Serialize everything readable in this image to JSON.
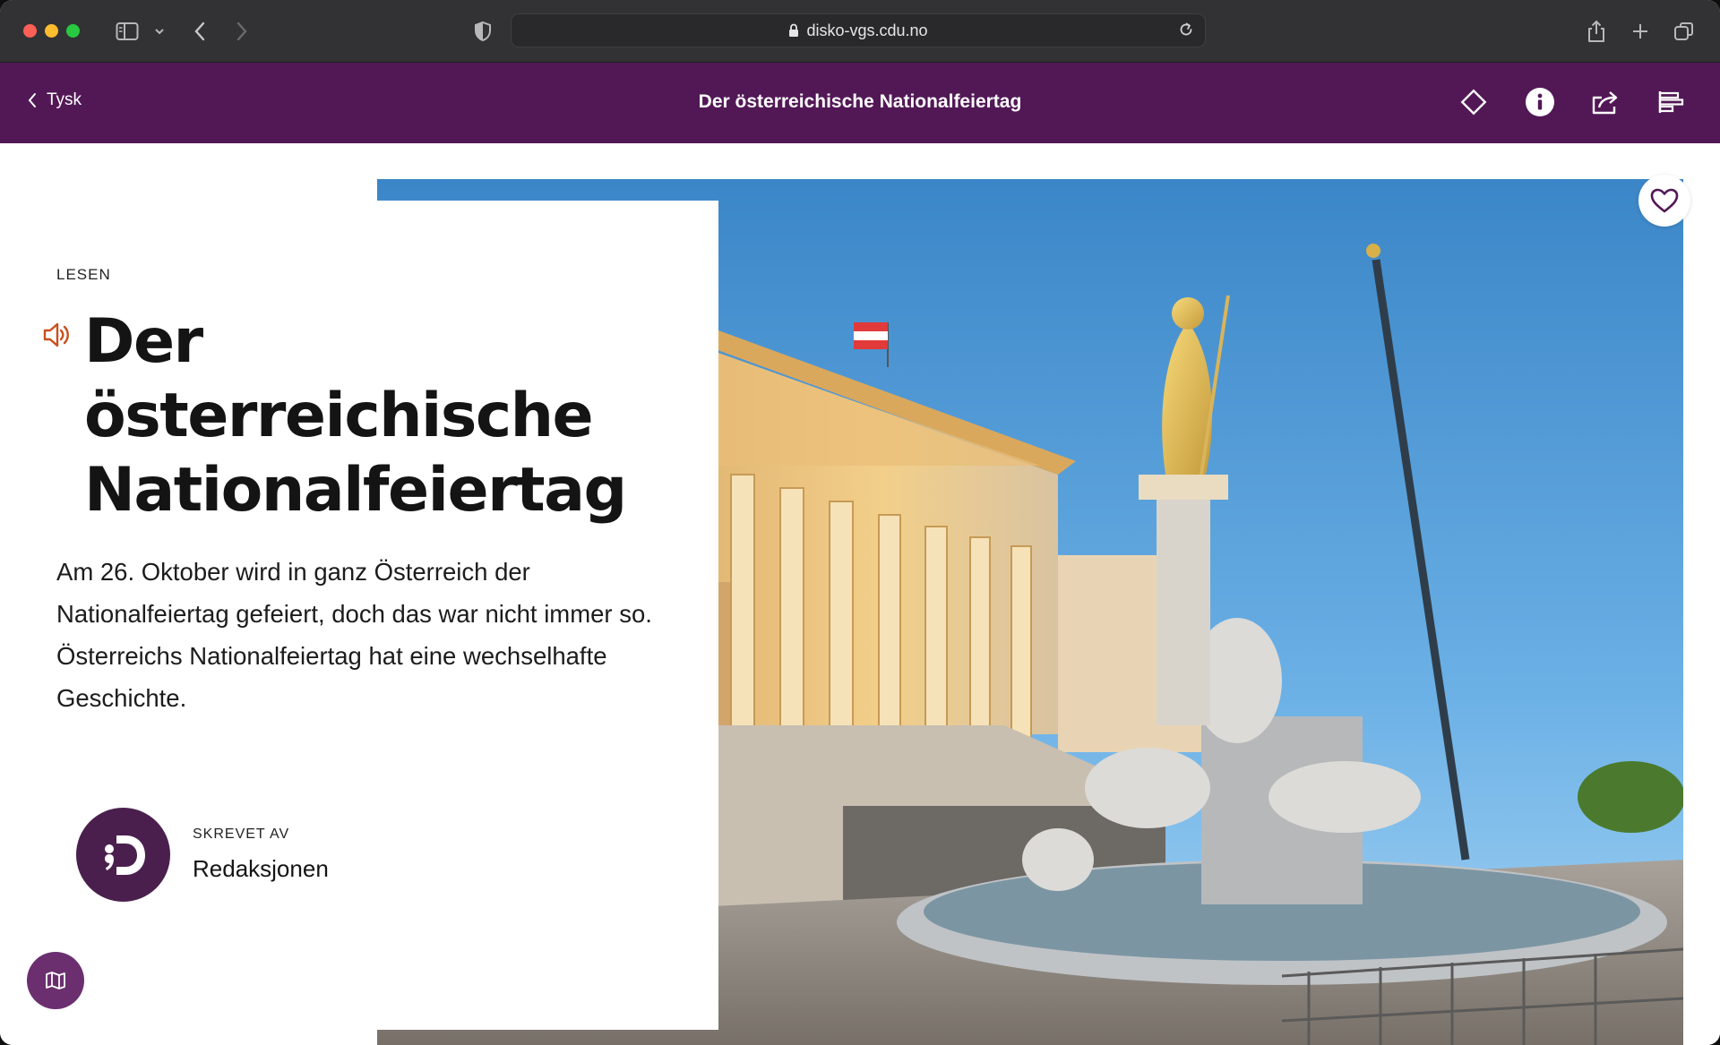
{
  "browser": {
    "url": "disko-vgs.cdu.no",
    "icons": [
      "sidebar-icon",
      "chevron-down-icon",
      "back-icon",
      "forward-icon",
      "shield-icon",
      "lock-icon",
      "reload-icon",
      "share-icon",
      "new-tab-icon",
      "tab-overview-icon"
    ]
  },
  "header": {
    "back_label": "Tysk",
    "title": "Der österreichische Nationalfeiertag",
    "icons": [
      "diamond-icon",
      "info-icon",
      "share-icon",
      "align-icon"
    ]
  },
  "article": {
    "kicker": "LESEN",
    "title_lines": [
      "Der",
      "österreichische",
      "Nationalfeiertag"
    ],
    "lede": "Am 26. Oktober wird in ganz Österreich der Nationalfeiertag gefeiert, doch das war nicht immer so. Österreichs Nationalfeiertag hat eine wechselhafte Geschichte.",
    "author_label": "SKREVET AV",
    "author_name": "Redaksjonen"
  },
  "colors": {
    "brand_purple": "#521856",
    "avatar_purple": "#4a1f4d",
    "map_button": "#6b2f70",
    "speaker_accent": "#c8501e"
  }
}
